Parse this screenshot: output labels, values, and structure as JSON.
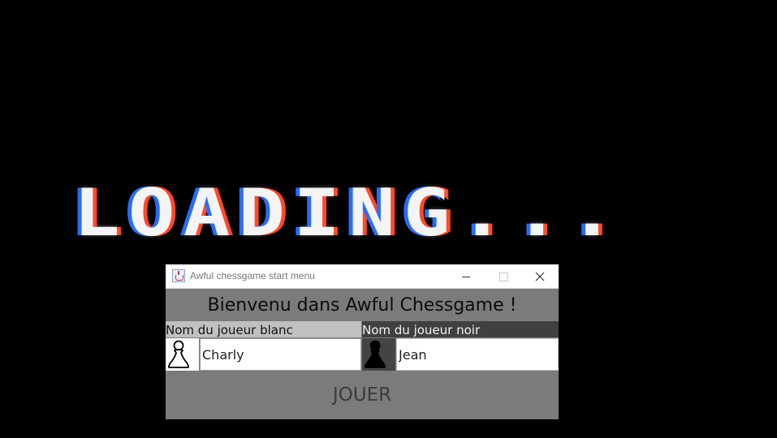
{
  "background": {
    "loading_text": "LOADING..."
  },
  "window": {
    "title": "Awful chessgame start menu",
    "icon": "java-icon",
    "welcome_text": "Bienvenu dans Awful Chessgame !",
    "white_player": {
      "label": "Nom du joueur blanc",
      "value": "Charly",
      "icon": "white-pawn-icon"
    },
    "black_player": {
      "label": "Nom du joueur noir",
      "value": "Jean",
      "icon": "black-pawn-icon"
    },
    "play_label": "JOUER"
  },
  "colors": {
    "window_bg": "#7b7b7b",
    "white_label_bg": "#c0c0c0",
    "black_label_bg": "#404040"
  }
}
